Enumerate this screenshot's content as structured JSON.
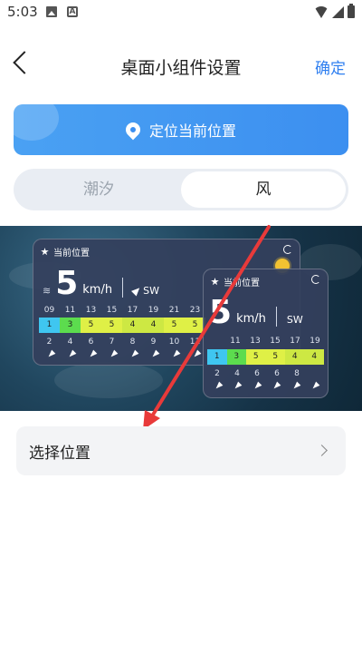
{
  "status_bar": {
    "time": "5:03",
    "app_icon_letter": "A"
  },
  "header": {
    "title": "桌面小组件设置",
    "confirm_label": "确定"
  },
  "locate_button": {
    "label": "定位当前位置"
  },
  "segment": {
    "tabs": [
      {
        "label": "潮汐",
        "selected": false
      },
      {
        "label": "风",
        "selected": true
      }
    ]
  },
  "widget_large": {
    "location": "当前位置",
    "speed": "5",
    "unit": "km/h",
    "direction": "SW",
    "hours": [
      "09",
      "11",
      "13",
      "15",
      "17",
      "19",
      "21",
      "23"
    ],
    "levels": [
      "1",
      "3",
      "5",
      "5",
      "4",
      "4",
      "5",
      "5"
    ],
    "numbers": [
      "2",
      "4",
      "6",
      "7",
      "8",
      "9",
      "10",
      "11"
    ]
  },
  "widget_small": {
    "location": "当前位置",
    "speed": "5",
    "unit": "km/h",
    "direction": "SW",
    "hours": [
      "11",
      "13",
      "15",
      "17",
      "19"
    ],
    "levels": [
      "1",
      "3",
      "5",
      "5",
      "4",
      "4"
    ],
    "numbers": [
      "2",
      "4",
      "6",
      "6",
      "8"
    ]
  },
  "level_colors": {
    "1": "#3fc6f0",
    "3": "#5cdc4e",
    "4": "#cde843",
    "5": "#dff046"
  },
  "select_location": {
    "label": "选择位置"
  },
  "colors": {
    "accent": "#2f7ff0",
    "arrow": "#e83a3a"
  }
}
